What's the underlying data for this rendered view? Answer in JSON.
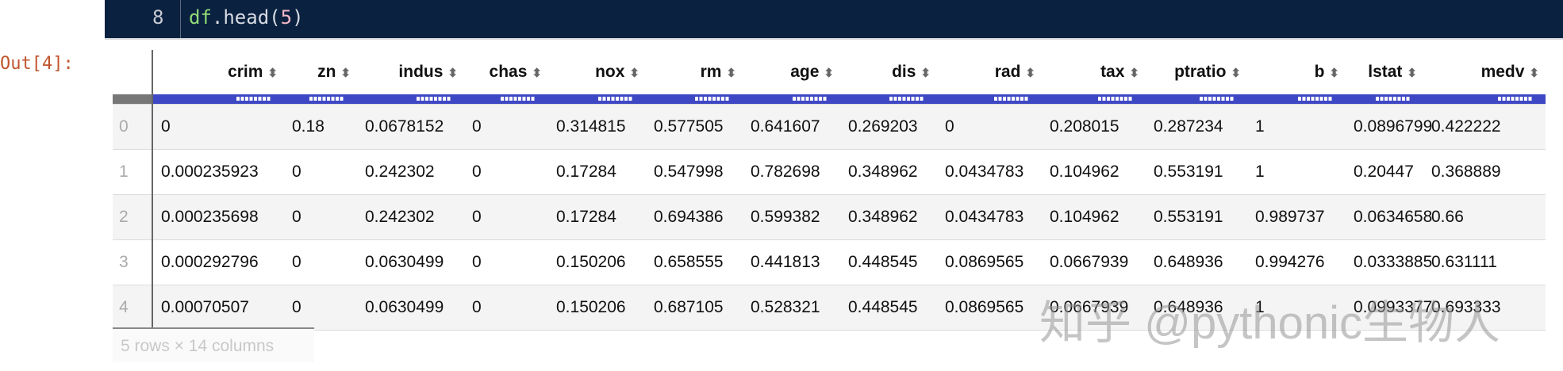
{
  "code_cell": {
    "line_number": "8",
    "code_obj": "df",
    "code_method": ".head(",
    "code_arg": "5",
    "code_close": ")"
  },
  "output_prompt": "Out[4]:",
  "table": {
    "columns": [
      "crim",
      "zn",
      "indus",
      "chas",
      "nox",
      "rm",
      "age",
      "dis",
      "rad",
      "tax",
      "ptratio",
      "b",
      "lstat",
      "medv"
    ],
    "index": [
      "0",
      "1",
      "2",
      "3",
      "4"
    ],
    "rows": [
      [
        "0",
        "0.18",
        "0.0678152",
        "0",
        "0.314815",
        "0.577505",
        "0.641607",
        "0.269203",
        "0",
        "0.208015",
        "0.287234",
        "1",
        "0.0896799",
        "0.422222"
      ],
      [
        "0.000235923",
        "0",
        "0.242302",
        "0",
        "0.17284",
        "0.547998",
        "0.782698",
        "0.348962",
        "0.0434783",
        "0.104962",
        "0.553191",
        "1",
        "0.20447",
        "0.368889"
      ],
      [
        "0.000235698",
        "0",
        "0.242302",
        "0",
        "0.17284",
        "0.694386",
        "0.599382",
        "0.348962",
        "0.0434783",
        "0.104962",
        "0.553191",
        "0.989737",
        "0.0634658",
        "0.66"
      ],
      [
        "0.000292796",
        "0",
        "0.0630499",
        "0",
        "0.150206",
        "0.658555",
        "0.441813",
        "0.448545",
        "0.0869565",
        "0.0667939",
        "0.648936",
        "0.994276",
        "0.0333885",
        "0.631111"
      ],
      [
        "0.00070507",
        "0",
        "0.0630499",
        "0",
        "0.150206",
        "0.687105",
        "0.528321",
        "0.448545",
        "0.0869565",
        "0.0667939",
        "0.648936",
        "1",
        "0.0993377",
        "0.693333"
      ]
    ],
    "footer": "5 rows × 14 columns"
  },
  "watermark": "知乎 @pythonic生物人",
  "colors": {
    "code_bg": "#0b2140",
    "filter_bar": "#3f48c4",
    "prompt": "#c0542d"
  }
}
